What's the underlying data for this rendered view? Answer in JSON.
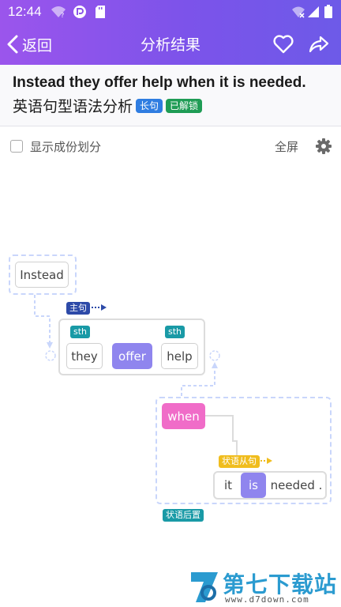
{
  "status_bar": {
    "time": "12:44"
  },
  "app_bar": {
    "back_label": "返回",
    "title": "分析结果"
  },
  "sentence": {
    "text": "Instead they offer help when it is needed.",
    "subtitle": "英语句型语法分析",
    "tags": [
      "长句",
      "已解锁"
    ]
  },
  "options": {
    "show_components_label": "显示成份划分",
    "fullscreen_label": "全屏"
  },
  "diagram": {
    "adverb_word": "Instead",
    "main_clause_label": "主句",
    "main_words": [
      "they",
      "offer",
      "help"
    ],
    "sth_labels": [
      "sth",
      "sth"
    ],
    "clause_conj": "when",
    "adverbial_clause_label": "状语从句",
    "clause_words": [
      "it",
      "is",
      "needed ."
    ],
    "postposition_label": "状语后置"
  },
  "watermark": {
    "name": "第七下载站",
    "url": "www.d7down.com"
  },
  "colors": {
    "app_bar": "#8b55ea",
    "verb": "#8f85ee",
    "conjunction": "#f06cc8",
    "sth_label": "#199aa6"
  }
}
